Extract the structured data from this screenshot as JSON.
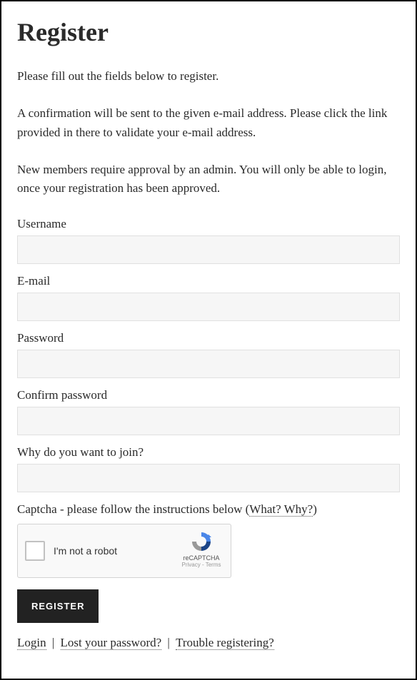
{
  "heading": "Register",
  "intro": {
    "p1": "Please fill out the fields below to register.",
    "p2": "A confirmation will be sent to the given e-mail address. Please click the link provided in there to validate your e-mail address.",
    "p3": "New members require approval by an admin. You will only be able to login, once your registration has been approved."
  },
  "fields": {
    "username": {
      "label": "Username",
      "value": ""
    },
    "email": {
      "label": "E-mail",
      "value": ""
    },
    "password": {
      "label": "Password",
      "value": ""
    },
    "confirm": {
      "label": "Confirm password",
      "value": ""
    },
    "why": {
      "label": "Why do you want to join?",
      "value": ""
    }
  },
  "captcha": {
    "label_prefix": "Captcha - please follow the instructions below (",
    "link": "What? Why?",
    "label_suffix": ")",
    "robot_text": "I'm not a robot",
    "brand": "reCAPTCHA",
    "terms": "Privacy - Terms"
  },
  "submit_label": "REGISTER",
  "footer_links": {
    "login": "Login",
    "lost": "Lost your password?",
    "trouble": "Trouble registering?",
    "sep": " | "
  }
}
